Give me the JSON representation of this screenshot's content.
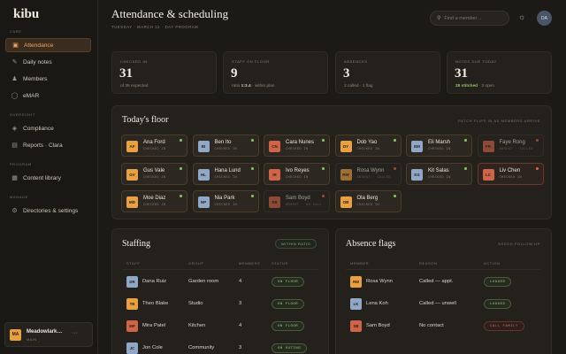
{
  "brand": "kibu",
  "sidebar": {
    "sections": {
      "care": "CARE",
      "oversight": "OVERSIGHT",
      "program": "PROGRAM",
      "manage": "MANAGE"
    },
    "items": [
      {
        "label": "Attendance",
        "icon": "calendar-icon"
      },
      {
        "label": "Daily notes",
        "icon": "pencil-icon"
      },
      {
        "label": "Members",
        "icon": "people-icon"
      },
      {
        "label": "eMAR",
        "icon": "pill-icon"
      },
      {
        "label": "Compliance",
        "icon": "shield-icon"
      },
      {
        "label": "Reports · Clara",
        "icon": "document-icon"
      },
      {
        "label": "Content library",
        "icon": "book-icon"
      },
      {
        "label": "Directories & settings",
        "icon": "gear-icon"
      }
    ],
    "user": {
      "initials": "MA",
      "name": "Meadowlark…",
      "role": "MAIN",
      "more": "···"
    }
  },
  "header": {
    "title": "Attendance & scheduling",
    "subline": "TUESDAY · MARCH 12 · DAY PROGRAM",
    "search_placeholder": "Find a member…",
    "avatar": "DA"
  },
  "stats": [
    {
      "label": "CHECKED IN",
      "value": "31",
      "sub_pre": "of 36 expected",
      "sub_bold": "",
      "sub_post": ""
    },
    {
      "label": "STAFF ON FLOOR",
      "value": "9",
      "sub_pre": "ratio ",
      "sub_bold": "1:3.4",
      "sub_post": " · within plan"
    },
    {
      "label": "ABSENCES",
      "value": "3",
      "sub_pre": "2 called · 1 flag",
      "sub_bold": "",
      "sub_post": ""
    },
    {
      "label": "NOTES DUE TODAY",
      "value": "31",
      "sub_ok": "28 stitched",
      "sub_post": " · 3 open"
    }
  ],
  "floor": {
    "title": "Today's floor",
    "note": "PATCH FLIPS IN AS MEMBERS ARRIVE",
    "tiles": [
      {
        "initials": "AF",
        "name": "Ana Ford",
        "status": "CHECKED IN",
        "color": "#e8a040",
        "state": "in"
      },
      {
        "initials": "BI",
        "name": "Ben Ito",
        "status": "CHECKED IN",
        "color": "#8fa8c8",
        "state": "in"
      },
      {
        "initials": "CN",
        "name": "Cara Nunes",
        "status": "CHECKED IN",
        "color": "#d06448",
        "state": "in"
      },
      {
        "initials": "DY",
        "name": "Dob Yao",
        "status": "CHECKED IN",
        "color": "#e8a040",
        "state": "in"
      },
      {
        "initials": "EM",
        "name": "Eli Marsh",
        "status": "CHECKED IN",
        "color": "#8fa8c8",
        "state": "in"
      },
      {
        "initials": "FR",
        "name": "Faye Rong",
        "status": "ABSENT · CALLED",
        "color": "#d06448",
        "state": "absent"
      },
      {
        "initials": "GV",
        "name": "Gus Vale",
        "status": "CHECKED IN",
        "color": "#e8a040",
        "state": "in"
      },
      {
        "initials": "HL",
        "name": "Hana Lund",
        "status": "CHECKED IN",
        "color": "#8fa8c8",
        "state": "in"
      },
      {
        "initials": "IR",
        "name": "Ivo Reyes",
        "status": "CHECKED IN",
        "color": "#d06448",
        "state": "in"
      },
      {
        "initials": "RW",
        "name": "Rosa Wynn",
        "status": "ABSENT · CALLED",
        "color": "#e8a040",
        "state": "absent"
      },
      {
        "initials": "KS",
        "name": "Kit Salas",
        "status": "CHECKED IN",
        "color": "#8fa8c8",
        "state": "in"
      },
      {
        "initials": "LC",
        "name": "Liv Chen",
        "status": "CHECKED IN",
        "color": "#d06448",
        "state": "flag"
      },
      {
        "initials": "MD",
        "name": "Moe Diaz",
        "status": "CHECKED IN",
        "color": "#e8a040",
        "state": "in"
      },
      {
        "initials": "NP",
        "name": "Nia Park",
        "status": "CHECKED IN",
        "color": "#8fa8c8",
        "state": "in"
      },
      {
        "initials": "SB",
        "name": "Sam Boyd",
        "status": "ABSENT · NO CALL",
        "color": "#d06448",
        "state": "absent"
      },
      {
        "initials": "OB",
        "name": "Ola Berg",
        "status": "CHECKED IN",
        "color": "#e8a040",
        "state": "in"
      }
    ]
  },
  "staffing": {
    "title": "Staffing",
    "badge": "WITHIN RATIO",
    "columns": [
      "STAFF",
      "GROUP",
      "MEMBERS",
      "STATUS"
    ],
    "rows": [
      {
        "initials": "DR",
        "name": "Dana Ruiz",
        "group": "Garden room",
        "members": "4",
        "status": "ON FLOOR",
        "color": "#8fa8c8"
      },
      {
        "initials": "TB",
        "name": "Theo Blake",
        "group": "Studio",
        "members": "3",
        "status": "ON FLOOR",
        "color": "#e8a040"
      },
      {
        "initials": "MP",
        "name": "Mira Patel",
        "group": "Kitchen",
        "members": "4",
        "status": "ON FLOOR",
        "color": "#d06448"
      },
      {
        "initials": "JC",
        "name": "Jon Cole",
        "group": "Community",
        "members": "3",
        "status": "ON OUTING",
        "color": "#8fa8c8"
      }
    ]
  },
  "absence": {
    "title": "Absence flags",
    "note": "NEEDS FOLLOW-UP",
    "columns": [
      "MEMBER",
      "REASON",
      "ACTION"
    ],
    "rows": [
      {
        "initials": "RW",
        "name": "Rosa Wynn",
        "reason": "Called — appt.",
        "action": "LOGGED",
        "color": "#e8a040",
        "warn": false
      },
      {
        "initials": "LK",
        "name": "Lena Koh",
        "reason": "Called — unwell",
        "action": "LOGGED",
        "color": "#8fa8c8",
        "warn": false
      },
      {
        "initials": "SB",
        "name": "Sam Boyd",
        "reason": "No contact",
        "action": "CALL FAMILY",
        "color": "#d06448",
        "warn": true
      }
    ]
  },
  "colors": {
    "accent": "#f0a65c",
    "ok": "#7fc05a",
    "flag": "#e05a44"
  }
}
